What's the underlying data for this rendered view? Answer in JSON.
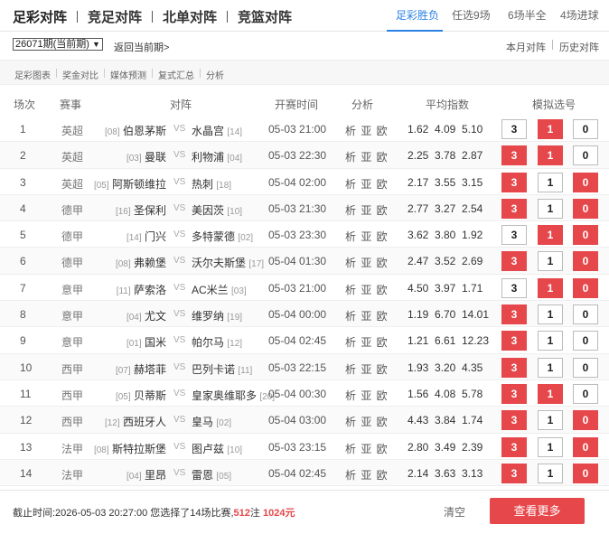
{
  "main_tabs": [
    "足彩对阵",
    "竞足对阵",
    "北单对阵",
    "竞篮对阵"
  ],
  "sub_tabs": [
    "足彩胜负",
    "任选9场",
    "6场半全",
    "4场进球"
  ],
  "period_select": "26071期(当前期)",
  "back_link": "返回当前期>",
  "right_links": [
    "本月对阵",
    "历史对阵"
  ],
  "tools": [
    "足彩图表",
    "奖金对比",
    "媒体预测",
    "复式汇总",
    "分析"
  ],
  "columns": {
    "idx": "场次",
    "league": "赛事",
    "match": "对阵",
    "time": "开赛时间",
    "analysis": "分析",
    "odds": "平均指数",
    "picks": "模拟选号"
  },
  "vs_label": "VS",
  "analysis_label": "析 亚 欧",
  "pick_labels": [
    "3",
    "1",
    "0"
  ],
  "matches": [
    {
      "idx": "1",
      "league": "英超",
      "home_rank": "[08]",
      "home": "伯恩茅斯",
      "away": "水晶宫",
      "away_rank": "[14]",
      "time": "05-03 21:00",
      "odds": [
        "1.62",
        "4.09",
        "5.10"
      ],
      "selected": [
        false,
        true,
        false
      ]
    },
    {
      "idx": "2",
      "league": "英超",
      "home_rank": "[03]",
      "home": "曼联",
      "away": "利物浦",
      "away_rank": "[04]",
      "time": "05-03 22:30",
      "odds": [
        "2.25",
        "3.78",
        "2.87"
      ],
      "selected": [
        true,
        true,
        false
      ]
    },
    {
      "idx": "3",
      "league": "英超",
      "home_rank": "[05]",
      "home": "阿斯顿维拉",
      "away": "热刺",
      "away_rank": "[18]",
      "time": "05-04 02:00",
      "odds": [
        "2.17",
        "3.55",
        "3.15"
      ],
      "selected": [
        true,
        false,
        true
      ]
    },
    {
      "idx": "4",
      "league": "德甲",
      "home_rank": "[16]",
      "home": "圣保利",
      "away": "美因茨",
      "away_rank": "[10]",
      "time": "05-03 21:30",
      "odds": [
        "2.77",
        "3.27",
        "2.54"
      ],
      "selected": [
        true,
        false,
        true
      ]
    },
    {
      "idx": "5",
      "league": "德甲",
      "home_rank": "[14]",
      "home": "门兴",
      "away": "多特蒙德",
      "away_rank": "[02]",
      "time": "05-03 23:30",
      "odds": [
        "3.62",
        "3.80",
        "1.92"
      ],
      "selected": [
        false,
        true,
        true
      ]
    },
    {
      "idx": "6",
      "league": "德甲",
      "home_rank": "[08]",
      "home": "弗赖堡",
      "away": "沃尔夫斯堡",
      "away_rank": "[17]",
      "time": "05-04 01:30",
      "odds": [
        "2.47",
        "3.52",
        "2.69"
      ],
      "selected": [
        true,
        false,
        true
      ]
    },
    {
      "idx": "7",
      "league": "意甲",
      "home_rank": "[11]",
      "home": "萨索洛",
      "away": "AC米兰",
      "away_rank": "[03]",
      "time": "05-03 21:00",
      "odds": [
        "4.50",
        "3.97",
        "1.71"
      ],
      "selected": [
        false,
        true,
        true
      ]
    },
    {
      "idx": "8",
      "league": "意甲",
      "home_rank": "[04]",
      "home": "尤文",
      "away": "维罗纳",
      "away_rank": "[19]",
      "time": "05-04 00:00",
      "odds": [
        "1.19",
        "6.70",
        "14.01"
      ],
      "selected": [
        true,
        false,
        false
      ]
    },
    {
      "idx": "9",
      "league": "意甲",
      "home_rank": "[01]",
      "home": "国米",
      "away": "帕尔马",
      "away_rank": "[12]",
      "time": "05-04 02:45",
      "odds": [
        "1.21",
        "6.61",
        "12.23"
      ],
      "selected": [
        true,
        false,
        false
      ]
    },
    {
      "idx": "10",
      "league": "西甲",
      "home_rank": "[07]",
      "home": "赫塔菲",
      "away": "巴列卡诺",
      "away_rank": "[11]",
      "time": "05-03 22:15",
      "odds": [
        "1.93",
        "3.20",
        "4.35"
      ],
      "selected": [
        true,
        false,
        false
      ]
    },
    {
      "idx": "11",
      "league": "西甲",
      "home_rank": "[05]",
      "home": "贝蒂斯",
      "away": "皇家奥维耶多",
      "away_rank": "[20]",
      "time": "05-04 00:30",
      "odds": [
        "1.56",
        "4.08",
        "5.78"
      ],
      "selected": [
        true,
        true,
        false
      ]
    },
    {
      "idx": "12",
      "league": "西甲",
      "home_rank": "[12]",
      "home": "西班牙人",
      "away": "皇马",
      "away_rank": "[02]",
      "time": "05-04 03:00",
      "odds": [
        "4.43",
        "3.84",
        "1.74"
      ],
      "selected": [
        true,
        false,
        true
      ]
    },
    {
      "idx": "13",
      "league": "法甲",
      "home_rank": "[08]",
      "home": "斯特拉斯堡",
      "away": "图卢兹",
      "away_rank": "[10]",
      "time": "05-03 23:15",
      "odds": [
        "2.80",
        "3.49",
        "2.39"
      ],
      "selected": [
        true,
        false,
        true
      ]
    },
    {
      "idx": "14",
      "league": "法甲",
      "home_rank": "[04]",
      "home": "里昂",
      "away": "雷恩",
      "away_rank": "[05]",
      "time": "05-04 02:45",
      "odds": [
        "2.14",
        "3.63",
        "3.13"
      ],
      "selected": [
        true,
        false,
        true
      ]
    }
  ],
  "footer": {
    "prefix": "截止时间:2026-05-03 20:27:00 您选择了14场比赛,",
    "bets": "512",
    "bets_unit": "注 ",
    "amount": "1024元",
    "clear": "清空",
    "more": "查看更多"
  },
  "colors": {
    "accent": "#e6474b",
    "tab_active": "#2b82e4"
  }
}
